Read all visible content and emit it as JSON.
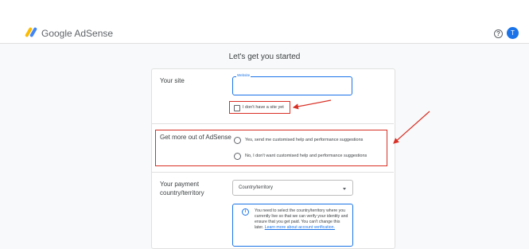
{
  "header": {
    "brand_google": "Google",
    "brand_product": "AdSense",
    "avatar_letter": "T"
  },
  "page": {
    "title": "Let's get you started"
  },
  "site": {
    "section_label": "Your site",
    "field_label": "Website",
    "value": "",
    "no_site_label": "I don't have a site yet"
  },
  "more": {
    "section_label": "Get more out of AdSense",
    "option_yes": "Yes, send me customised help and performance suggestions",
    "option_no": "No, I don't want customised help and performance suggestions"
  },
  "payment": {
    "section_label_line1": "Your payment",
    "section_label_line2": "country/territory",
    "select_value": "Country/territory",
    "info_text": "You need to select the country/territory where you currently live so that we can verify your identity and ensure that you get paid. You can't change this later.",
    "info_link": "Learn more about account verification."
  },
  "colors": {
    "accent": "#1a73e8",
    "highlight": "#d93025"
  }
}
